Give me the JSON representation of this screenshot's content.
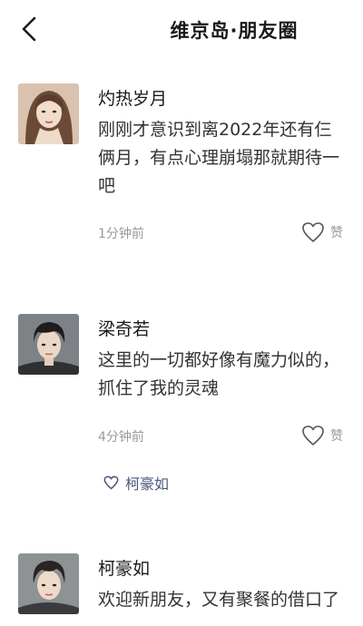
{
  "header": {
    "title": "维京岛·朋友圈"
  },
  "posts": [
    {
      "author": "灼热岁月",
      "content": "刚刚才意识到离2022年还有仨\n俩月，有点心理崩塌那就期待一\n吧",
      "time": "1分钟前",
      "like_label": "赞"
    },
    {
      "author": "梁奇若",
      "content": "这里的一切都好像有魔力似的，\n抓住了我的灵魂",
      "time": "4分钟前",
      "like_label": "赞",
      "liked_by": "柯豪如"
    },
    {
      "author": "柯豪如",
      "content": "欢迎新朋友，又有聚餐的借口了"
    }
  ]
}
